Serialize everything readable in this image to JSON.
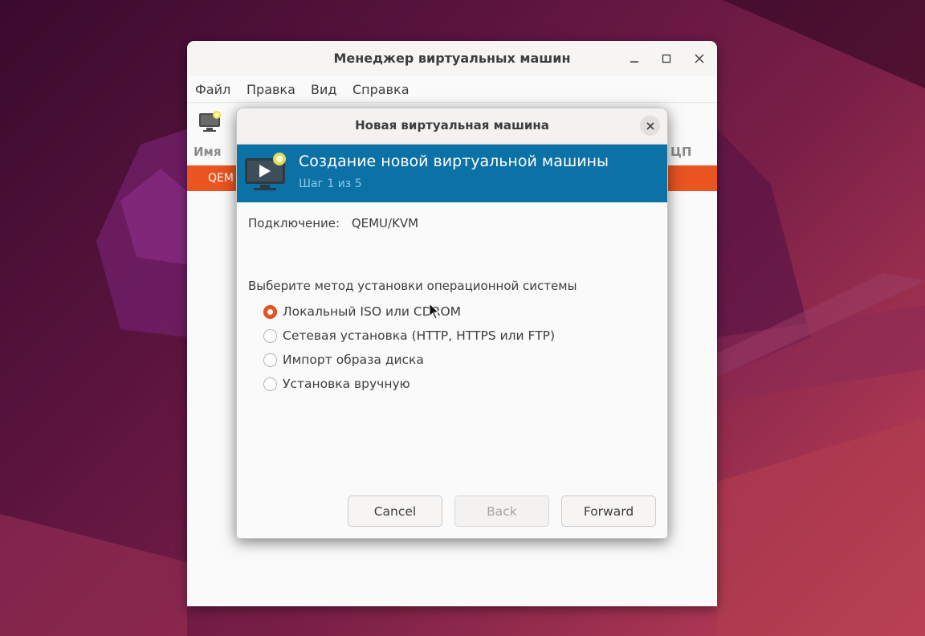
{
  "main_window": {
    "title": "Менеджер виртуальных машин",
    "menu": [
      "Файл",
      "Правка",
      "Вид",
      "Справка"
    ],
    "columns": {
      "name": "Имя",
      "cpu": "ЦП"
    },
    "vm_row": {
      "name": "QEM"
    }
  },
  "dialog": {
    "title": "Новая виртуальная машина",
    "banner_title": "Создание новой виртуальной машины",
    "banner_subtitle": "Шаг 1 из 5",
    "connection_label": "Подключение:",
    "connection_value": "QEMU/KVM",
    "install_method_label": "Выберите метод установки операционной системы",
    "install_options": [
      {
        "label": "Локальный ISO или CDROM",
        "selected": true
      },
      {
        "label": "Сетевая установка (HTTP, HTTPS или FTP)",
        "selected": false
      },
      {
        "label": "Импорт образа диска",
        "selected": false
      },
      {
        "label": "Установка вручную",
        "selected": false
      }
    ],
    "buttons": {
      "cancel": "Cancel",
      "back": "Back",
      "forward": "Forward"
    }
  },
  "icons": {
    "window_controls": [
      "minimize-icon",
      "maximize-icon",
      "close-icon"
    ],
    "toolbar": "new-vm-icon",
    "banner": "new-vm-icon"
  },
  "colors": {
    "accent": "#e95420",
    "banner": "#0c72a5",
    "banner_subtitle": "#8ec8ea"
  }
}
